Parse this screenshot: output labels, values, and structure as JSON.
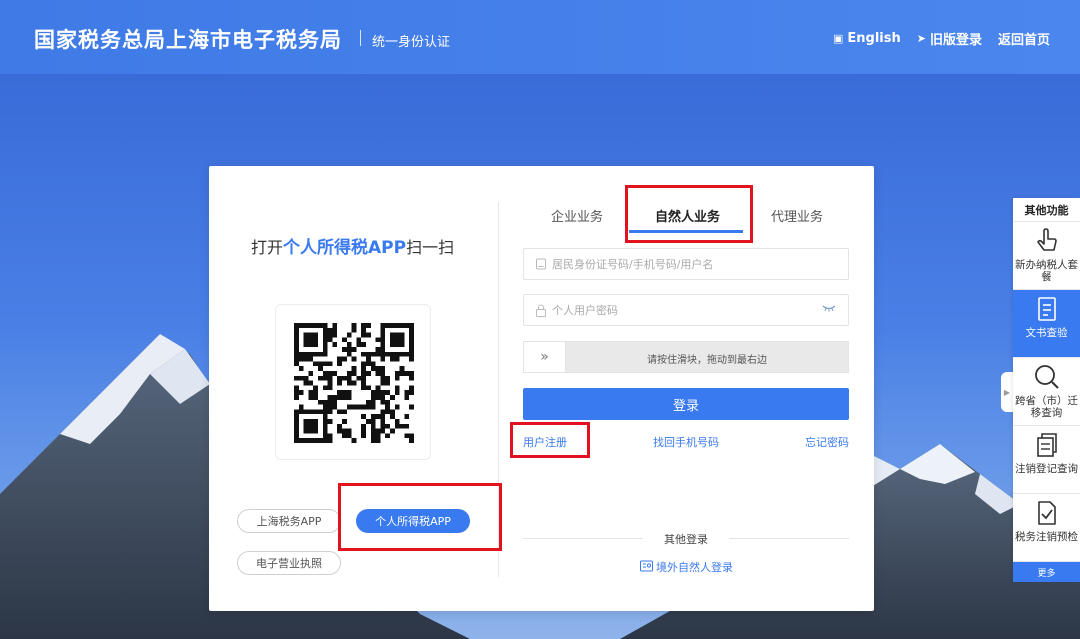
{
  "header": {
    "title": "国家税务总局上海市电子税务局",
    "subtitle": "统一身份认证",
    "links": [
      {
        "icon": "language-icon",
        "label": "English"
      },
      {
        "icon": "send-icon",
        "label": "旧版登录"
      },
      {
        "icon": "",
        "label": "返回首页"
      }
    ]
  },
  "scan": {
    "prefix": "打开",
    "highlight": "个人所得税APP",
    "suffix": "扫一扫",
    "apps": [
      {
        "label": "上海税务APP",
        "active": false
      },
      {
        "label": "个人所得税APP",
        "active": true
      },
      {
        "label": "电子营业执照",
        "active": false
      }
    ]
  },
  "tabs": [
    {
      "label": "企业业务",
      "active": false
    },
    {
      "label": "自然人业务",
      "active": true
    },
    {
      "label": "代理业务",
      "active": false
    }
  ],
  "form": {
    "id_placeholder": "居民身份证号码/手机号码/用户名",
    "password_placeholder": "个人用户密码",
    "slider_text": "请按住滑块，拖动到最右边",
    "login_label": "登录",
    "register_label": "用户注册",
    "recover_phone_label": "找回手机号码",
    "forgot_password_label": "忘记密码"
  },
  "other_login": {
    "title": "其他登录",
    "foreign_label": "境外自然人登录"
  },
  "side_panel": {
    "title": "其他功能",
    "items": [
      {
        "icon": "hand-pointer-icon",
        "label": "新办纳税人套餐",
        "active": false
      },
      {
        "icon": "document-icon",
        "label": "文书查验",
        "active": true
      },
      {
        "icon": "magnifier-icon",
        "label": "跨省（市）迁移查询",
        "active": false
      },
      {
        "icon": "copy-icon",
        "label": "注销登记查询",
        "active": false
      },
      {
        "icon": "file-check-icon",
        "label": "税务注销预检",
        "active": false
      }
    ],
    "more_label": "更多"
  },
  "colors": {
    "primary": "#3a7af0",
    "highlight_box": "#e0141e"
  }
}
